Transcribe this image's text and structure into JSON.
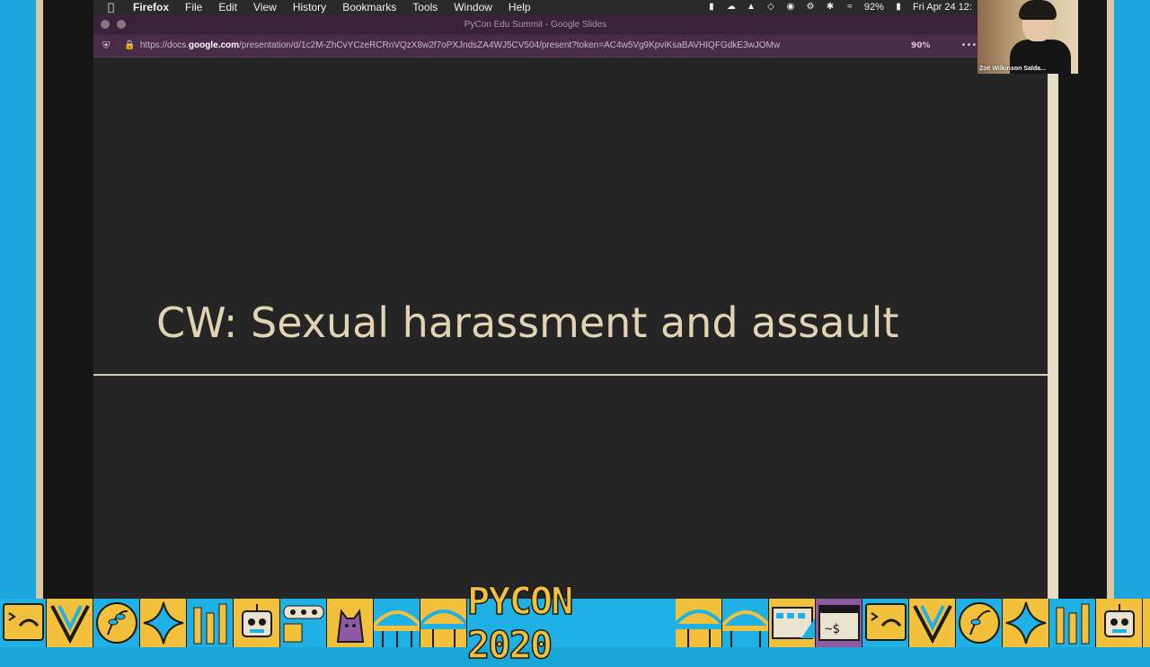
{
  "menubar": {
    "apple_icon": "apple-icon",
    "app": "Firefox",
    "items": [
      "File",
      "Edit",
      "View",
      "History",
      "Bookmarks",
      "Tools",
      "Window",
      "Help"
    ],
    "battery": "92%",
    "clock": "Fri Apr 24  12:"
  },
  "browser": {
    "window_title": "PyCon Edu Summit - Google Slides",
    "url_prefix": "https://docs.",
    "url_domain": "google.com",
    "url_rest": "/presentation/d/1c2M-ZhCvYCzeRCRnVQzX8w2f7oPXJndsZA4WJ5CV504/present?token=AC4w5Vg9KpviKsaBAVHIQFGdkE3wJOMw",
    "zoom": "90%",
    "more": "•••"
  },
  "slide": {
    "title": "CW: Sexual harassment and assault"
  },
  "webcam": {
    "name": "Zoë Wilkinson Salda..."
  },
  "banner": {
    "logo_text": "PYCON 2020"
  },
  "colors": {
    "slide_bg": "#252525",
    "title_color": "#e2d3b3",
    "banner_yellow": "#f2c03a",
    "banner_blue": "#1fb1e6",
    "browser_chrome": "#4a2c48"
  }
}
